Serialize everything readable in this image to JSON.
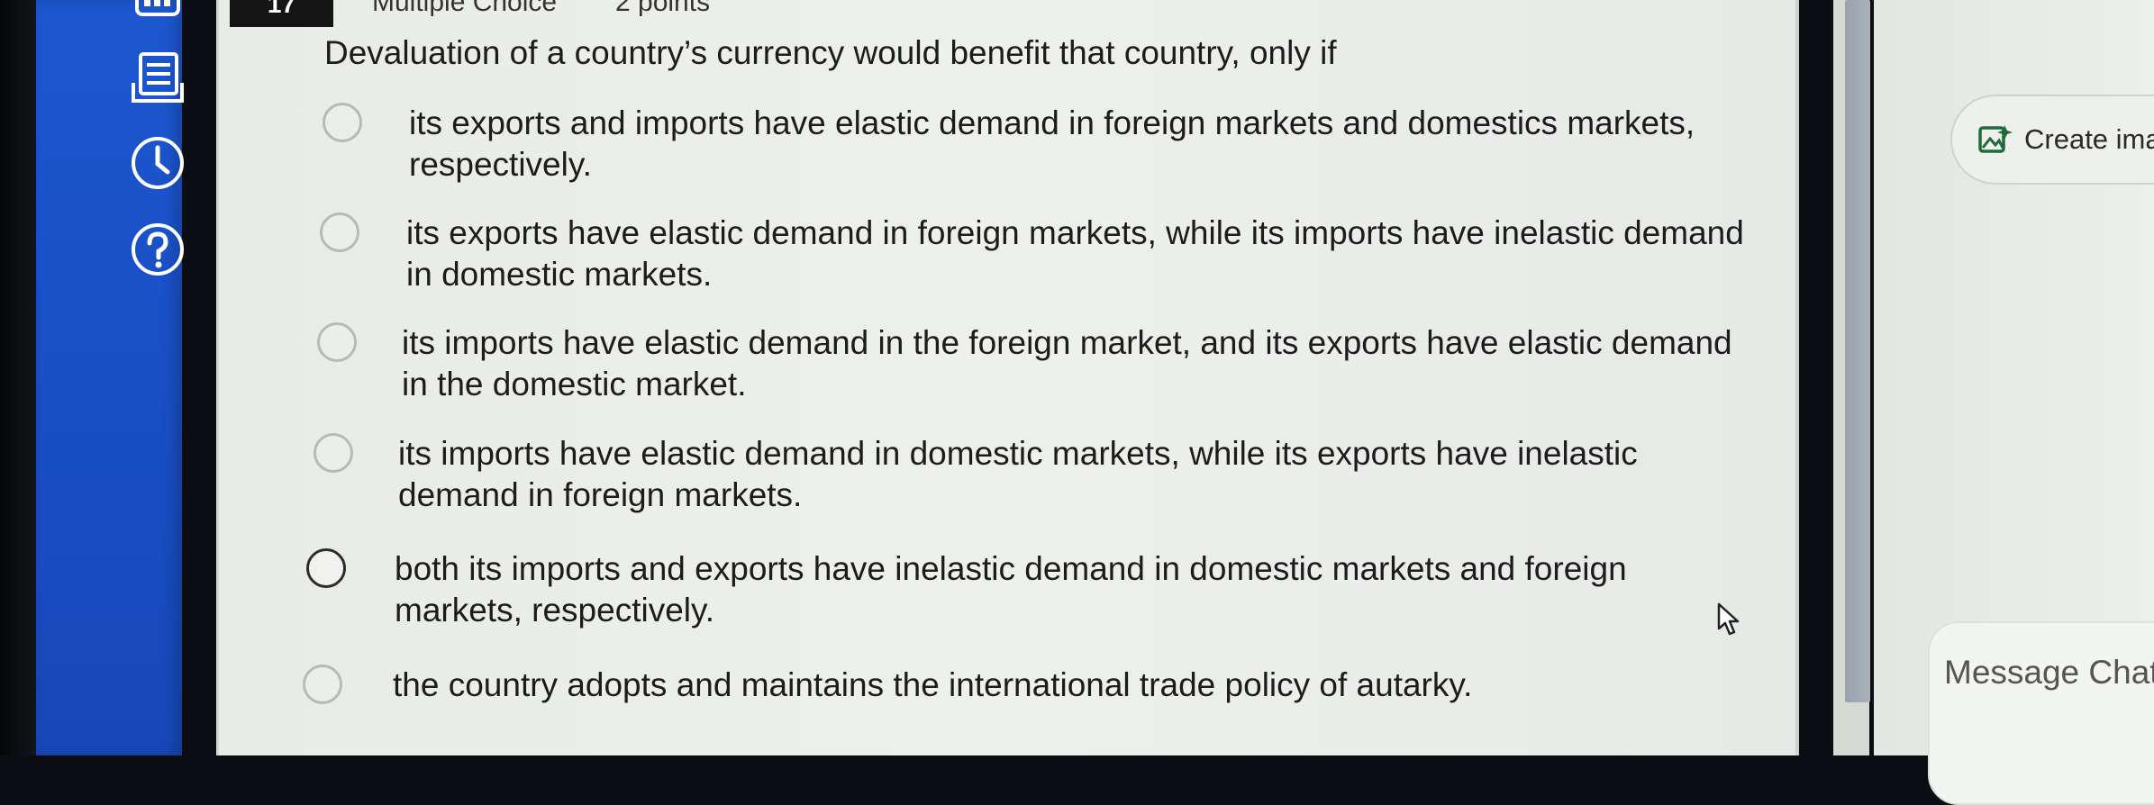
{
  "header": {
    "question_number": "17",
    "question_type": "Multiple Choice",
    "points": "2 points"
  },
  "question": {
    "text": "Devaluation of a country’s currency would benefit that country, only if"
  },
  "options": [
    {
      "line1": "its exports and imports have elastic demand in foreign markets and domestics markets,",
      "line2": "respectively."
    },
    {
      "line1": "its exports have elastic demand in foreign markets, while its imports have inelastic demand",
      "line2": "in domestic markets."
    },
    {
      "line1": "its imports have elastic demand in the foreign market, and its exports have elastic demand",
      "line2": "in the domestic market."
    },
    {
      "line1": "its imports have elastic demand in domestic markets, while its exports have inelastic",
      "line2": "demand in foreign markets."
    },
    {
      "line1": "both its imports and exports have inelastic demand in domestic markets and foreign",
      "line2": "markets, respectively."
    },
    {
      "line1": "the country adopts and maintains the international trade policy of autarky.",
      "line2": ""
    }
  ],
  "sidebar": {
    "icons": [
      "calculator-icon",
      "document-icon",
      "clock-icon",
      "help-icon"
    ]
  },
  "right_panel": {
    "create_label": "Create ima",
    "message_placeholder": "Message Chat"
  },
  "colors": {
    "sidebar_blue": "#1a4fc6",
    "panel_bg": "#eceee9",
    "text": "#1c1c1c"
  }
}
